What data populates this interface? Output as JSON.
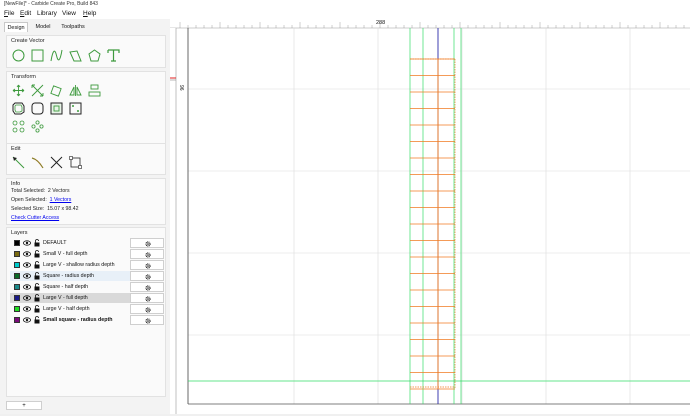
{
  "window": {
    "title": "[NewFile]* - Carbide Create Pro, Build 843"
  },
  "menu": [
    {
      "label": "File",
      "u": "F"
    },
    {
      "label": "Edit",
      "u": "E"
    },
    {
      "label": "Library",
      "u": ""
    },
    {
      "label": "View",
      "u": ""
    },
    {
      "label": "Help",
      "u": "H"
    }
  ],
  "tabs": [
    {
      "label": "Design",
      "active": true
    },
    {
      "label": "Model",
      "active": false
    },
    {
      "label": "Toolpaths",
      "active": false
    }
  ],
  "sections": {
    "create_vector": "Create Vector",
    "transform": "Transform",
    "edit": "Edit",
    "info": "Info",
    "layers": "Layers"
  },
  "create_vector_tools": [
    "circle-icon",
    "rectangle-icon",
    "curve-icon",
    "polyline-icon",
    "polygon-icon",
    "text-icon"
  ],
  "transform_tools": [
    "move-icon",
    "scale-icon",
    "rotate-icon",
    "mirror-icon",
    "align-icon",
    "offset-icon",
    "fillet-icon",
    "boolean-icon",
    "array-icon",
    "distribute-icon",
    "circular-array-icon"
  ],
  "edit_tools": [
    "node-edit-icon",
    "trim-icon",
    "cut-icon",
    "bounding-box-icon"
  ],
  "info": {
    "total_selected_label": "Total Selected:",
    "total_selected_value": "2 Vectors",
    "open_selected_label": "Open Selected:",
    "open_selected_value": "1 Vectors",
    "selected_size_label": "Selected Size:",
    "selected_size_value": "15.07 x 98.42",
    "check_cutter": "Check Cutter Access"
  },
  "layers": [
    {
      "name": "DEFAULT",
      "color": "#000000",
      "bold": false,
      "state": "normal"
    },
    {
      "name": "Small V - full depth",
      "color": "#7a6a10",
      "bold": false,
      "state": "normal"
    },
    {
      "name": "Large V - shallow radius depth",
      "color": "#00cccc",
      "bold": false,
      "state": "normal"
    },
    {
      "name": "Square - radius depth",
      "color": "#0a6b2a",
      "bold": false,
      "state": "highlight"
    },
    {
      "name": "Square - half depth",
      "color": "#1a8a8a",
      "bold": false,
      "state": "normal"
    },
    {
      "name": "Large V - full depth",
      "color": "#1a1a8a",
      "bold": false,
      "state": "selected"
    },
    {
      "name": "Large V - half depth",
      "color": "#22dd22",
      "bold": false,
      "state": "normal"
    },
    {
      "name": "Small square - radius depth",
      "color": "#7a0a7a",
      "bold": true,
      "state": "normal"
    }
  ],
  "add_layer_label": "+",
  "ruler": {
    "top_label": "288",
    "left_label": "96"
  },
  "colors": {
    "accent": "#3d9a3d",
    "cut_orange": "#f07a20",
    "guide_green": "#33dd66",
    "guide_blue": "#2a2aa8",
    "red_marker": "#e02020"
  }
}
